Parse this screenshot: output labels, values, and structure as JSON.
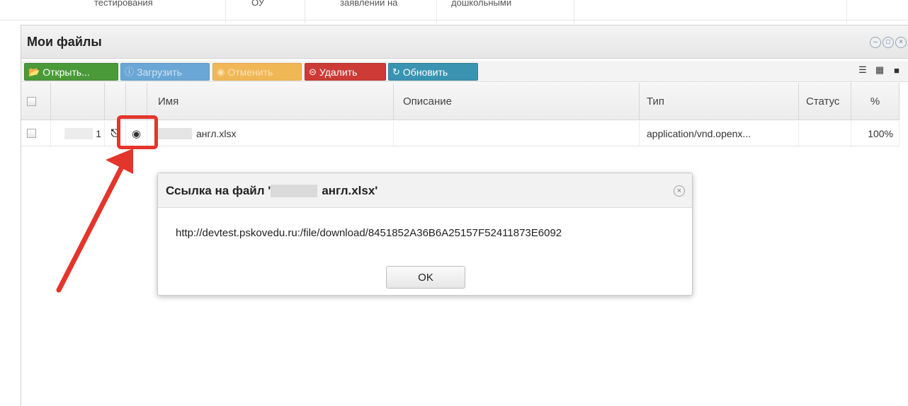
{
  "background_row": {
    "cells": [
      "тестирования",
      "ОУ",
      "заявлении на",
      "дошкольными"
    ]
  },
  "window": {
    "title": "Мои файлы",
    "controls": [
      "minimize",
      "maximize",
      "close"
    ]
  },
  "toolbar": {
    "open_label": "Открыть...",
    "upload_label": "Загрузить",
    "cancel_label": "Отменить",
    "delete_label": "Удалить",
    "refresh_label": "Обновить",
    "colors": {
      "open": "#4a9a3a",
      "upload": "#6aa7d6",
      "cancel": "#f0b757",
      "delete": "#cc3b36",
      "refresh": "#3a94b1"
    }
  },
  "grid": {
    "headers": {
      "name": "Имя",
      "description": "Описание",
      "type": "Тип",
      "status": "Статус",
      "percent": "%"
    },
    "rows": [
      {
        "num": "1",
        "name": "англ.xlsx",
        "description": "",
        "type": "application/vnd.openx...",
        "status": "",
        "percent": "100%"
      }
    ]
  },
  "dialog": {
    "title_prefix": "Ссылка на файл '",
    "title_suffix": "англ.xlsx'",
    "url": "http://devtest.pskovedu.ru:/file/download/8451852A36B6A25157F52411873E6092",
    "ok_label": "OK"
  },
  "annotation": {
    "color": "#e4352c"
  }
}
